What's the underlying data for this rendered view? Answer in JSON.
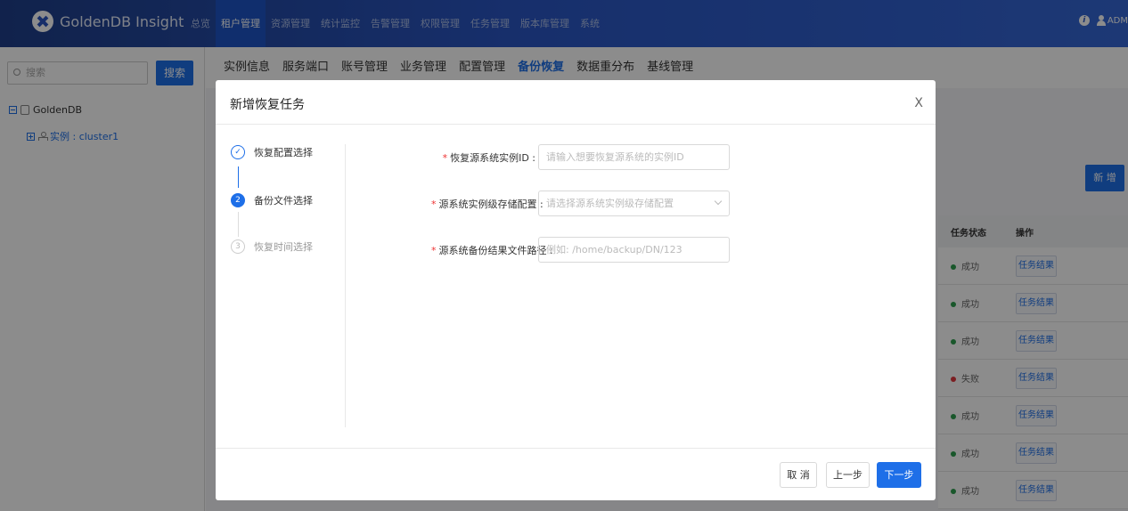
{
  "topbar": {
    "brand": "GoldenDB Insight",
    "nav": [
      {
        "label": "总览",
        "active": false
      },
      {
        "label": "租户管理",
        "active": true
      },
      {
        "label": "资源管理",
        "active": false
      },
      {
        "label": "统计监控",
        "active": false
      },
      {
        "label": "告警管理",
        "active": false
      },
      {
        "label": "权限管理",
        "active": false
      },
      {
        "label": "任务管理",
        "active": false
      },
      {
        "label": "版本库管理",
        "active": false
      },
      {
        "label": "系统",
        "active": false
      }
    ],
    "user": "ADM"
  },
  "sidebar": {
    "search_placeholder": "搜索",
    "search_button": "搜索",
    "tree_root": "GoldenDB",
    "tree_child": "实例 : cluster1"
  },
  "main": {
    "tabs": [
      "实例信息",
      "服务端口",
      "账号管理",
      "业务管理",
      "配置管理",
      "备份恢复",
      "数据重分布",
      "基线管理"
    ],
    "active_tab": "备份恢复",
    "new_button": "新 增",
    "table": {
      "headers": [
        "任务状态",
        "操作"
      ],
      "rows": [
        {
          "status": "成功",
          "color": "#2e9e4f",
          "action": "任务结果"
        },
        {
          "status": "成功",
          "color": "#2e9e4f",
          "action": "任务结果"
        },
        {
          "status": "成功",
          "color": "#2e9e4f",
          "action": "任务结果"
        },
        {
          "status": "失败",
          "color": "#e0383e",
          "action": "任务结果"
        },
        {
          "status": "成功",
          "color": "#2e9e4f",
          "action": "任务结果"
        },
        {
          "status": "成功",
          "color": "#2e9e4f",
          "action": "任务结果"
        },
        {
          "status": "成功",
          "color": "#2e9e4f",
          "action": "任务结果"
        }
      ]
    }
  },
  "modal": {
    "title": "新增恢复任务",
    "close": "X",
    "steps": [
      {
        "index": "✓",
        "label": "恢复配置选择",
        "state": "done"
      },
      {
        "index": "2",
        "label": "备份文件选择",
        "state": "active"
      },
      {
        "index": "3",
        "label": "恢复时间选择",
        "state": "wait"
      }
    ],
    "fields": [
      {
        "required": "*",
        "label": "恢复源系统实例ID :",
        "placeholder": "请输入想要恢复源系统的实例ID",
        "type": "input"
      },
      {
        "required": "*",
        "label": "源系统实例级存储配置 :",
        "placeholder": "请选择源系统实例级存储配置",
        "type": "select"
      },
      {
        "required": "*",
        "label": "源系统备份结果文件路径 :",
        "placeholder": "例如: /home/backup/DN/123",
        "type": "input"
      }
    ],
    "buttons": {
      "cancel": "取 消",
      "prev": "上一步",
      "next": "下一步"
    }
  }
}
